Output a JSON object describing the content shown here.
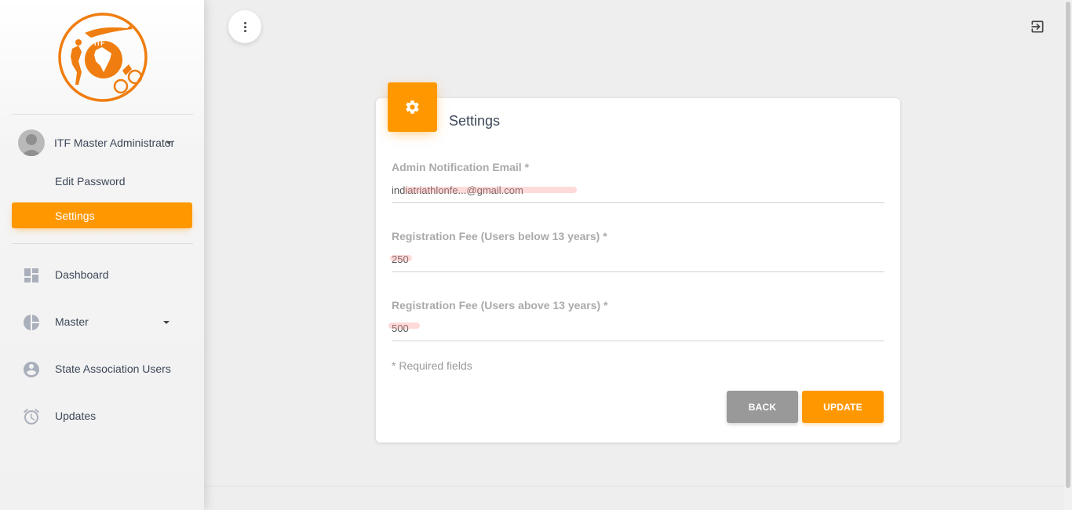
{
  "sidebar": {
    "logo_text": "ITF",
    "user_name": "ITF Master Administrator",
    "user_menu": [
      {
        "label": "Edit Password"
      },
      {
        "label": "Settings"
      }
    ],
    "nav": [
      {
        "label": "Dashboard",
        "icon": "dashboard-icon"
      },
      {
        "label": "Master",
        "icon": "pie-chart-icon"
      },
      {
        "label": "State Association Users",
        "icon": "account-circle-icon"
      },
      {
        "label": "Updates",
        "icon": "alarm-icon"
      }
    ]
  },
  "header": {
    "menu_icon": "more-vert-icon",
    "logout_icon": "logout-icon"
  },
  "settings": {
    "title": "Settings",
    "icon": "gear-icon",
    "fields": [
      {
        "label": "Admin Notification Email *",
        "value": "indiatriathlonfe...@gmail.com"
      },
      {
        "label": "Registration Fee (Users below 13 years) *",
        "value": "250"
      },
      {
        "label": "Registration Fee (Users above 13 years) *",
        "value": "500"
      }
    ],
    "required_note": "* Required fields",
    "back_label": "BACK",
    "update_label": "UPDATE"
  },
  "colors": {
    "accent": "#ff9800",
    "logo": "#ef7d0f",
    "back_button": "#999999",
    "background": "#eeeeee"
  }
}
